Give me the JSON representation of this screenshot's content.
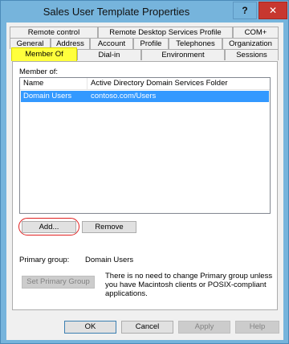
{
  "window": {
    "title": "Sales User Template Properties",
    "help_label": "?",
    "close_label": "✕"
  },
  "tabs": {
    "row1": [
      "Remote control",
      "Remote Desktop Services Profile",
      "COM+"
    ],
    "row2": [
      "General",
      "Address",
      "Account",
      "Profile",
      "Telephones",
      "Organization"
    ],
    "row3": [
      "Member Of",
      "Dial-in",
      "Environment",
      "Sessions"
    ],
    "active": "Member Of"
  },
  "member_of": {
    "label": "Member of:",
    "columns": [
      "Name",
      "Active Directory Domain Services Folder"
    ],
    "rows": [
      {
        "name": "Domain Users",
        "folder": "contoso.com/Users",
        "selected": true
      }
    ]
  },
  "buttons": {
    "add": "Add...",
    "remove": "Remove",
    "set_primary": "Set Primary Group"
  },
  "primary_group": {
    "label": "Primary group:",
    "value": "Domain Users",
    "note_line1": "There is no need to change Primary group unless",
    "note_line2": "you have Macintosh clients or POSIX-compliant",
    "note_line3": "applications."
  },
  "dialog_buttons": {
    "ok": "OK",
    "cancel": "Cancel",
    "apply": "Apply",
    "help": "Help"
  },
  "colors": {
    "title_bar": "#76b4dc",
    "close_button": "#c7372f",
    "active_tab_highlight": "#ffff3c",
    "selection": "#3399ff",
    "annotation_circle": "#e02020"
  }
}
